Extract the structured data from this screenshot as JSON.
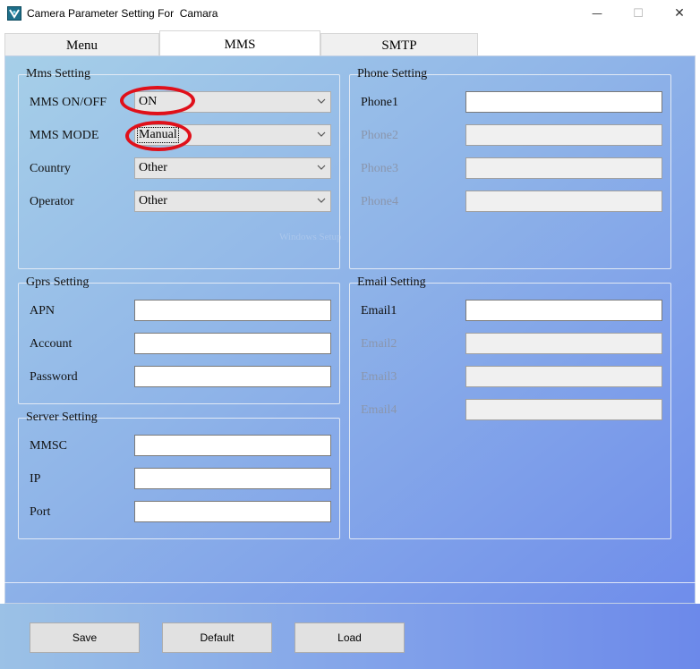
{
  "window": {
    "title": "Camera Parameter Setting For  Camara",
    "minimize_glyph": "—",
    "maximize_glyph": "☐",
    "close_glyph": "✕",
    "icon": "camera-app-icon"
  },
  "tabs": [
    {
      "label": "Menu",
      "active": false
    },
    {
      "label": "MMS",
      "active": true
    },
    {
      "label": "SMTP",
      "active": false
    }
  ],
  "mms_setting": {
    "title": "Mms Setting",
    "rows": [
      {
        "label": "MMS ON/OFF",
        "value": "ON",
        "highlighted": true
      },
      {
        "label": "MMS MODE",
        "value": "Manual",
        "highlighted": true,
        "focused": true
      },
      {
        "label": "Country",
        "value": "Other"
      },
      {
        "label": "Operator",
        "value": "Other"
      }
    ]
  },
  "phone_setting": {
    "title": "Phone Setting",
    "rows": [
      {
        "label": "Phone1",
        "value": "",
        "enabled": true
      },
      {
        "label": "Phone2",
        "value": "",
        "enabled": false
      },
      {
        "label": "Phone3",
        "value": "",
        "enabled": false
      },
      {
        "label": "Phone4",
        "value": "",
        "enabled": false
      }
    ]
  },
  "gprs_setting": {
    "title": "Gprs Setting",
    "rows": [
      {
        "label": "APN",
        "value": ""
      },
      {
        "label": "Account",
        "value": ""
      },
      {
        "label": "Password",
        "value": ""
      }
    ]
  },
  "server_setting": {
    "title": "Server Setting",
    "rows": [
      {
        "label": "MMSC",
        "value": ""
      },
      {
        "label": "IP",
        "value": ""
      },
      {
        "label": "Port",
        "value": ""
      }
    ]
  },
  "email_setting": {
    "title": "Email Setting",
    "rows": [
      {
        "label": "Email1",
        "value": "",
        "enabled": true
      },
      {
        "label": "Email2",
        "value": "",
        "enabled": false
      },
      {
        "label": "Email3",
        "value": "",
        "enabled": false
      },
      {
        "label": "Email4",
        "value": "",
        "enabled": false
      }
    ]
  },
  "watermark": "Windows Setup",
  "buttons": {
    "save": "Save",
    "default": "Default",
    "load": "Load"
  },
  "colors": {
    "annotation": "#e0101a",
    "gradient_start": "#a6cfe8",
    "gradient_end": "#6f8deb"
  }
}
